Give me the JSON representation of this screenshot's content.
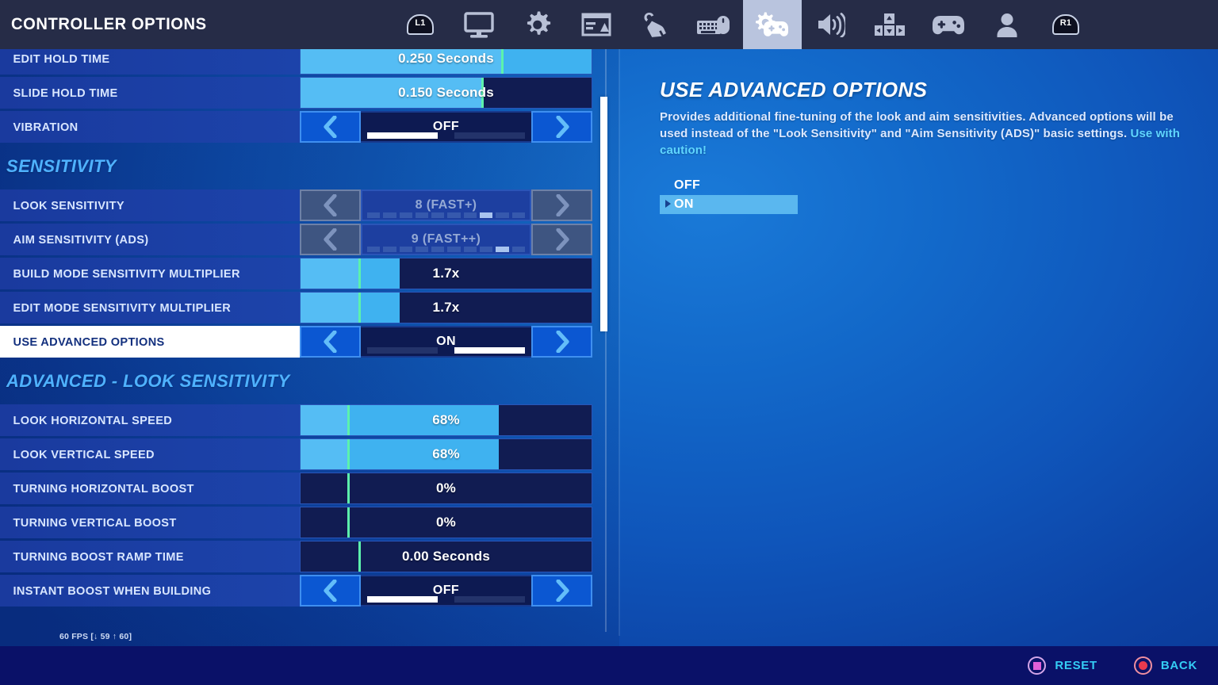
{
  "header": {
    "title": "CONTROLLER OPTIONS",
    "left_bumper": "L1",
    "right_bumper": "R1",
    "nav": [
      {
        "name": "bumper-l1-badge",
        "type": "bumper",
        "label": "L1"
      },
      {
        "name": "tab-video-icon",
        "type": "monitor"
      },
      {
        "name": "tab-game-settings-icon",
        "type": "gear"
      },
      {
        "name": "tab-hud-layout-icon",
        "type": "hud"
      },
      {
        "name": "tab-brightness-touch-icon",
        "type": "touch"
      },
      {
        "name": "tab-keyboard-mouse-icon",
        "type": "kbm"
      },
      {
        "name": "tab-controller-options-icon",
        "type": "controller-gear",
        "selected": true
      },
      {
        "name": "tab-audio-icon",
        "type": "speaker"
      },
      {
        "name": "tab-input-keybinds-icon",
        "type": "wasd"
      },
      {
        "name": "tab-controller-config-icon",
        "type": "gamepad"
      },
      {
        "name": "tab-account-icon",
        "type": "person"
      },
      {
        "name": "bumper-r1-badge",
        "type": "bumper",
        "label": "R1"
      }
    ]
  },
  "settings": {
    "rows": [
      {
        "kind": "slider",
        "name": "edit-hold-time",
        "label": "EDIT HOLD TIME",
        "value": "0.250 Seconds",
        "fill_pct": 100,
        "tick_pct": 69
      },
      {
        "kind": "slider",
        "name": "slide-hold-time",
        "label": "SLIDE HOLD TIME",
        "value": "0.150 Seconds",
        "fill_pct": 62,
        "tick_pct": 62
      },
      {
        "kind": "arrows",
        "name": "vibration",
        "label": "VIBRATION",
        "value": "OFF",
        "segments": 2,
        "active": 0
      },
      {
        "kind": "header",
        "name": "section-sensitivity",
        "label": "SENSITIVITY"
      },
      {
        "kind": "stepper",
        "name": "look-sensitivity",
        "label": "LOOK SENSITIVITY",
        "value": "8 (FAST+)",
        "notches": 10,
        "active": 8,
        "disabled": true
      },
      {
        "kind": "stepper",
        "name": "aim-sensitivity-ads",
        "label": "AIM SENSITIVITY (ADS)",
        "value": "9 (FAST++)",
        "notches": 10,
        "active": 9,
        "disabled": true
      },
      {
        "kind": "slider",
        "name": "build-mode-sensitivity-multiplier",
        "label": "BUILD MODE SENSITIVITY MULTIPLIER",
        "value": "1.7x",
        "fill_pct": 34,
        "tick_pct": 20
      },
      {
        "kind": "slider",
        "name": "edit-mode-sensitivity-multiplier",
        "label": "EDIT MODE SENSITIVITY MULTIPLIER",
        "value": "1.7x",
        "fill_pct": 34,
        "tick_pct": 20
      },
      {
        "kind": "arrows",
        "name": "use-advanced-options",
        "label": "USE ADVANCED OPTIONS",
        "value": "ON",
        "segments": 2,
        "active": 1,
        "selected": true
      },
      {
        "kind": "header",
        "name": "section-advanced-look-sensitivity",
        "label": "ADVANCED - LOOK SENSITIVITY"
      },
      {
        "kind": "slider",
        "name": "look-horizontal-speed",
        "label": "LOOK HORIZONTAL SPEED",
        "value": "68%",
        "fill_pct": 68,
        "tick_pct": 16
      },
      {
        "kind": "slider",
        "name": "look-vertical-speed",
        "label": "LOOK VERTICAL SPEED",
        "value": "68%",
        "fill_pct": 68,
        "tick_pct": 16
      },
      {
        "kind": "slider",
        "name": "turning-horizontal-boost",
        "label": "TURNING HORIZONTAL BOOST",
        "value": "0%",
        "fill_pct": 0,
        "tick_pct": 16
      },
      {
        "kind": "slider",
        "name": "turning-vertical-boost",
        "label": "TURNING VERTICAL BOOST",
        "value": "0%",
        "fill_pct": 0,
        "tick_pct": 16
      },
      {
        "kind": "slider",
        "name": "turning-boost-ramp-time",
        "label": "TURNING BOOST RAMP TIME",
        "value": "0.00 Seconds",
        "fill_pct": 0,
        "tick_pct": 20
      },
      {
        "kind": "arrows",
        "name": "instant-boost-when-building",
        "label": "INSTANT BOOST WHEN BUILDING",
        "value": "OFF",
        "segments": 2,
        "active": 0
      }
    ]
  },
  "detail_panel": {
    "title": "USE ADVANCED OPTIONS",
    "description": "Provides additional fine-tuning of the look and aim sensitivities.  Advanced options will be used instead of the \"Look Sensitivity\" and \"Aim Sensitivity (ADS)\" basic settings.  ",
    "caution": "Use with caution!",
    "options": [
      {
        "label": "OFF",
        "active": false
      },
      {
        "label": "ON",
        "active": true
      }
    ]
  },
  "footer": {
    "fps": "60 FPS [↓ 59 ↑ 60]",
    "hints": [
      {
        "name": "reset",
        "button": "square",
        "label": "RESET"
      },
      {
        "name": "back",
        "button": "circle",
        "label": "BACK"
      }
    ]
  },
  "colors": {
    "accent_blue": "#3fb2f0",
    "tick_green": "#5cf2ac",
    "header_blue": "#4fb2ff",
    "caution_cyan": "#5fd6ff",
    "hint_cyan": "#34cdf5",
    "topbar": "#262c47",
    "footer_bar": "#0a1168"
  }
}
